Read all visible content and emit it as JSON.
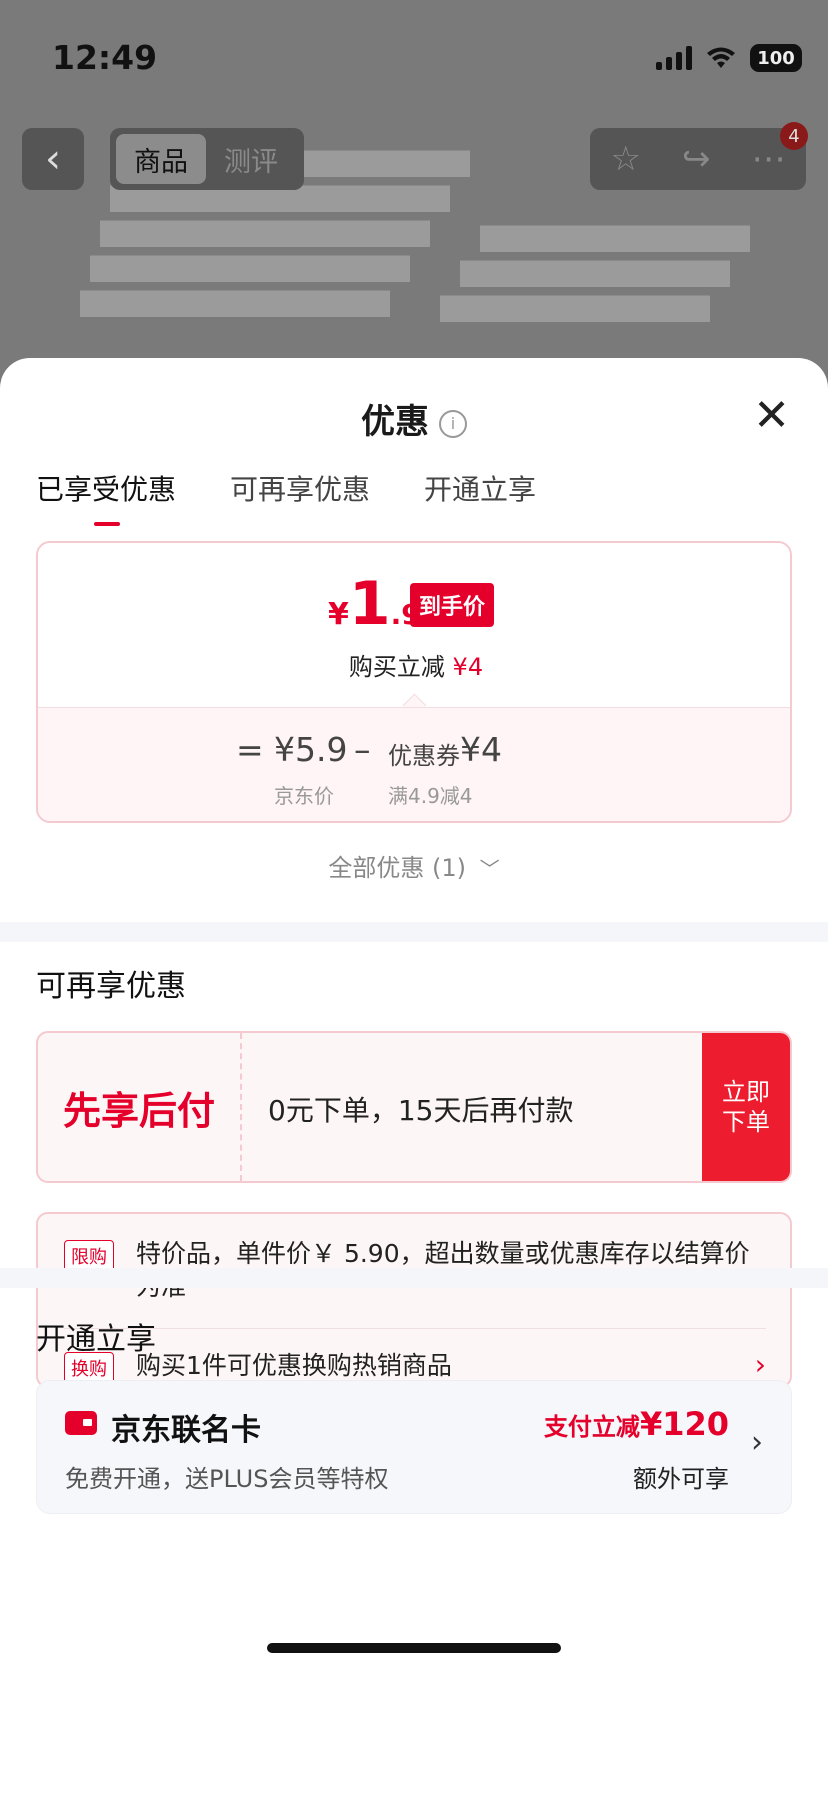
{
  "status_bar": {
    "time": "12:49",
    "battery": "100"
  },
  "nav": {
    "tabs": [
      "商品",
      "测评"
    ],
    "active_tab": "商品",
    "badge_count": "4"
  },
  "sheet": {
    "title": "优惠",
    "tabs": [
      "已享受优惠",
      "可再享优惠",
      "开通立享"
    ],
    "active_tab_index": 0,
    "final_price": {
      "currency": "¥",
      "integer": "1",
      "decimal": ".9",
      "tag": "到手价"
    },
    "buy_reduce": {
      "label": "购买立减",
      "amount": "¥4"
    },
    "breakdown": {
      "eq": "=",
      "jd_price": "¥5.9",
      "jd_price_label": "京东价",
      "minus": "–",
      "coupon_label": "优惠券",
      "coupon_amount": "¥4",
      "coupon_condition": "满4.9减4"
    },
    "all_discounts": "全部优惠 (1)",
    "section_more": {
      "title": "可再享优惠",
      "bnpl": {
        "label": "先享后付",
        "desc": "0元下单，15天后再付款",
        "button_line1": "立即",
        "button_line2": "下单"
      },
      "notes": [
        {
          "tag": "限购",
          "text": "特价品，单件价￥ 5.90，超出数量或优惠库存以结算价为准"
        },
        {
          "tag": "换购",
          "text": "购买1件可优惠换购热销商品"
        }
      ]
    },
    "section_open": {
      "title": "开通立享",
      "card": {
        "name": "京东联名卡",
        "sub": "免费开通，送PLUS会员等特权",
        "promo_prefix": "支付立减",
        "promo_amount": "¥120",
        "extra": "额外可享"
      }
    }
  },
  "colors": {
    "accent": "#e4002b",
    "panel_bg": "#fdf6f7",
    "border": "#f5c9d0"
  }
}
